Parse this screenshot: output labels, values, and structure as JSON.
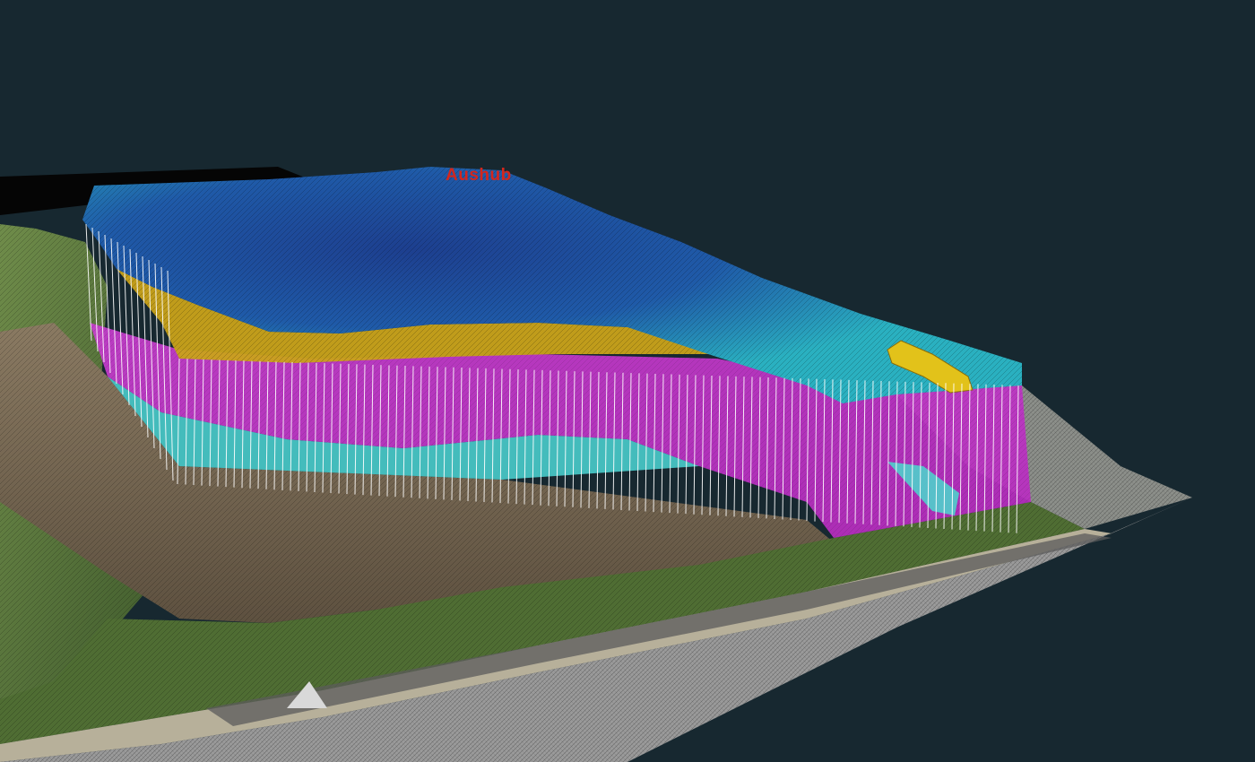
{
  "scene": {
    "label": "Aushub",
    "colors": {
      "background": "#172830",
      "label": "#d4261c",
      "excavation_top": "#2fb7c4",
      "excavation_deep": "#1f4f9a",
      "layer_magenta": "#c02ec4",
      "layer_yellow": "#c9a21a",
      "terrain_earth": "#7a6a54",
      "terrain_grass": "#5a7a3a",
      "road": "#c8c8c8",
      "posts": "#ffffff"
    }
  }
}
